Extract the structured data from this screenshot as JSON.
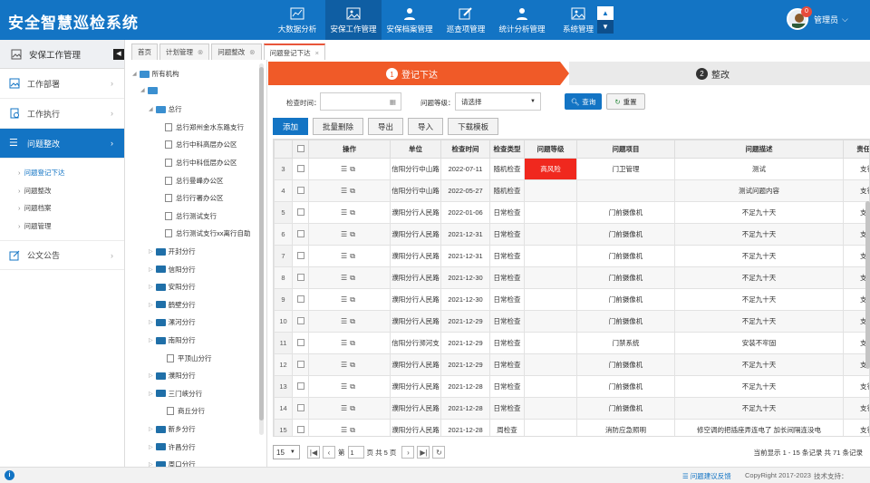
{
  "app": {
    "title": "安全智慧巡检系统",
    "colors": {
      "primary": "#1374c4",
      "accent": "#f05a28",
      "highlight": "#f0281e"
    }
  },
  "nav": [
    {
      "label": "大数据分析",
      "icon": "chart-icon"
    },
    {
      "label": "安保工作管理",
      "icon": "image-icon"
    },
    {
      "label": "安保档案管理",
      "icon": "user-icon"
    },
    {
      "label": "巡查项管理",
      "icon": "edit-icon"
    },
    {
      "label": "统计分析管理",
      "icon": "user-icon"
    },
    {
      "label": "系统管理",
      "icon": "image-icon"
    }
  ],
  "user": {
    "name": "管理员",
    "badge": "0"
  },
  "sidebar": {
    "title": "安保工作管理",
    "items": [
      {
        "label": "工作部署"
      },
      {
        "label": "工作执行"
      },
      {
        "label": "问题整改"
      }
    ],
    "sub": [
      "问题登记下达",
      "问题整改",
      "问题档案",
      "问题管理"
    ],
    "last": "公文公告"
  },
  "tabs": [
    "首页",
    "计划管理",
    "问题整改",
    "问题登记下达"
  ],
  "tree": [
    {
      "label": "所有机构",
      "lvl": 0,
      "type": "open"
    },
    {
      "label": "",
      "lvl": 1,
      "type": "open"
    },
    {
      "label": "总行",
      "lvl": 2,
      "type": "open"
    },
    {
      "label": "总行郑州金水东路支行",
      "lvl": 3,
      "type": "doc"
    },
    {
      "label": "总行中科高层办公区",
      "lvl": 3,
      "type": "doc"
    },
    {
      "label": "总行中科低层办公区",
      "lvl": 3,
      "type": "doc"
    },
    {
      "label": "总行曼峰办公区",
      "lvl": 3,
      "type": "doc"
    },
    {
      "label": "总行行署办公区",
      "lvl": 3,
      "type": "doc"
    },
    {
      "label": "总行测试支行",
      "lvl": 3,
      "type": "doc"
    },
    {
      "label": "总行测试支行xx离行自助",
      "lvl": 3,
      "type": "doc"
    },
    {
      "label": "开封分行",
      "lvl": 2,
      "type": "closed"
    },
    {
      "label": "信阳分行",
      "lvl": 2,
      "type": "closed"
    },
    {
      "label": "安阳分行",
      "lvl": 2,
      "type": "closed"
    },
    {
      "label": "鹤壁分行",
      "lvl": 2,
      "type": "closed"
    },
    {
      "label": "漯河分行",
      "lvl": 2,
      "type": "closed"
    },
    {
      "label": "南阳分行",
      "lvl": 2,
      "type": "closed"
    },
    {
      "label": "平顶山分行",
      "lvl": 2,
      "type": "doc"
    },
    {
      "label": "濮阳分行",
      "lvl": 2,
      "type": "closed"
    },
    {
      "label": "三门峡分行",
      "lvl": 2,
      "type": "closed"
    },
    {
      "label": "商丘分行",
      "lvl": 2,
      "type": "doc"
    },
    {
      "label": "新乡分行",
      "lvl": 2,
      "type": "closed"
    },
    {
      "label": "许昌分行",
      "lvl": 2,
      "type": "closed"
    },
    {
      "label": "周口分行",
      "lvl": 2,
      "type": "closed"
    }
  ],
  "steps": [
    {
      "num": "1",
      "label": "登记下达"
    },
    {
      "num": "2",
      "label": "整改"
    }
  ],
  "filters": {
    "time_label": "检查时间：",
    "level_label": "问题等级：",
    "level_value": "请选择",
    "search": "查询",
    "reset": "重置"
  },
  "toolbar": [
    "添加",
    "批量删除",
    "导出",
    "导入",
    "下载模板"
  ],
  "table": {
    "headers": [
      "",
      "操作",
      "单位",
      "检查时间",
      "检查类型",
      "问题等级",
      "问题项目",
      "问题描述",
      "责任部"
    ],
    "rows": [
      {
        "n": "3",
        "unit": "信阳分行中山路",
        "time": "2022-07-11",
        "type": "随机检查",
        "level": "高风险",
        "item": "门卫管理",
        "desc": "测试",
        "dept": "支行",
        "hi": true
      },
      {
        "n": "4",
        "unit": "信阳分行中山路",
        "time": "2022-05-27",
        "type": "随机检查",
        "level": "",
        "item": "",
        "desc": "测试问题内容",
        "dept": "支行"
      },
      {
        "n": "5",
        "unit": "濮阳分行人民路",
        "time": "2022-01-06",
        "type": "日常检查",
        "level": "",
        "item": "门前摄像机",
        "desc": "不足九十天",
        "dept": "支行"
      },
      {
        "n": "6",
        "unit": "濮阳分行人民路",
        "time": "2021-12-31",
        "type": "日常检查",
        "level": "",
        "item": "门前摄像机",
        "desc": "不足九十天",
        "dept": "支行"
      },
      {
        "n": "7",
        "unit": "濮阳分行人民路",
        "time": "2021-12-31",
        "type": "日常检查",
        "level": "",
        "item": "门前摄像机",
        "desc": "不足九十天",
        "dept": "支行"
      },
      {
        "n": "8",
        "unit": "濮阳分行人民路",
        "time": "2021-12-30",
        "type": "日常检查",
        "level": "",
        "item": "门前摄像机",
        "desc": "不足九十天",
        "dept": "支行"
      },
      {
        "n": "9",
        "unit": "濮阳分行人民路",
        "time": "2021-12-30",
        "type": "日常检查",
        "level": "",
        "item": "门前摄像机",
        "desc": "不足九十天",
        "dept": "支行"
      },
      {
        "n": "10",
        "unit": "濮阳分行人民路",
        "time": "2021-12-29",
        "type": "日常检查",
        "level": "",
        "item": "门前摄像机",
        "desc": "不足九十天",
        "dept": "支行"
      },
      {
        "n": "11",
        "unit": "信阳分行浉河支",
        "time": "2021-12-29",
        "type": "日常检查",
        "level": "",
        "item": "门禁系统",
        "desc": "安装不牢固",
        "dept": "支行"
      },
      {
        "n": "12",
        "unit": "濮阳分行人民路",
        "time": "2021-12-29",
        "type": "日常检查",
        "level": "",
        "item": "门前摄像机",
        "desc": "不足九十天",
        "dept": "支行"
      },
      {
        "n": "13",
        "unit": "濮阳分行人民路",
        "time": "2021-12-28",
        "type": "日常检查",
        "level": "",
        "item": "门前摄像机",
        "desc": "不足九十天",
        "dept": "支行"
      },
      {
        "n": "14",
        "unit": "濮阳分行人民路",
        "time": "2021-12-28",
        "type": "日常检查",
        "level": "",
        "item": "门前摄像机",
        "desc": "不足九十天",
        "dept": "支行"
      },
      {
        "n": "15",
        "unit": "濮阳分行人民路",
        "time": "2021-12-28",
        "type": "周检查",
        "level": "",
        "item": "消防应急照明",
        "desc": "修空调的把插座弄连电了 加长间隔连没电",
        "dept": "支行"
      }
    ]
  },
  "pager": {
    "size": "15",
    "page_prefix": "第",
    "page": "1",
    "page_suffix": "页 共 5 页",
    "info": "当前显示 1 - 15 条记录 共 71 条记录"
  },
  "footer": {
    "info": "i",
    "link": "☰ 问题建议反馈",
    "copy": "CopyRight 2017-2023",
    "support": "技术支持："
  }
}
